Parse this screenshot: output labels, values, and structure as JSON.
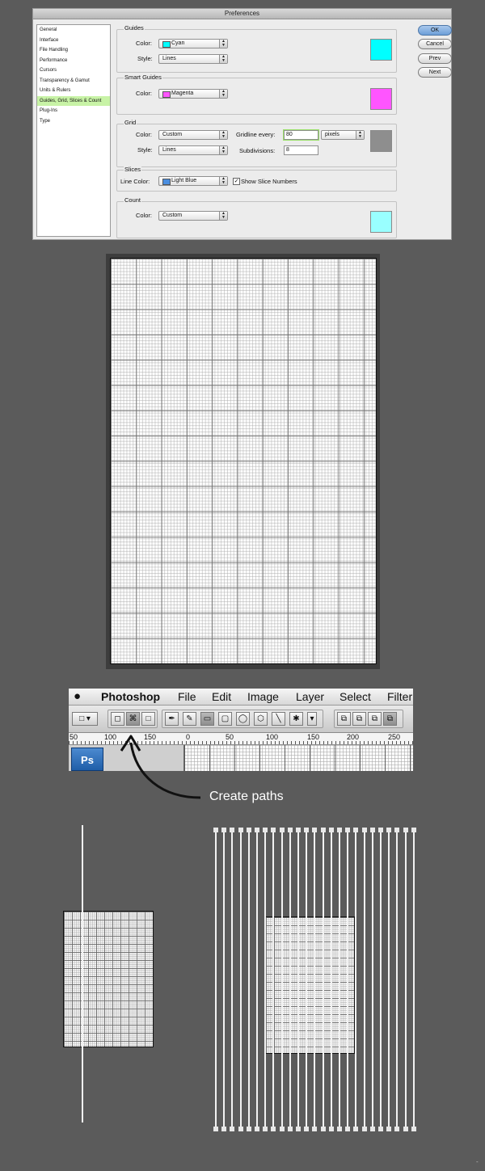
{
  "preferences": {
    "title": "Preferences",
    "categories": [
      "General",
      "Interface",
      "File Handling",
      "Performance",
      "Cursors",
      "Transparency & Gamut",
      "Units & Rulers",
      "Guides, Grid, Slices & Count",
      "Plug-Ins",
      "Type"
    ],
    "selected_category": "Guides, Grid, Slices & Count",
    "guides": {
      "title": "Guides",
      "color_label": "Color:",
      "color_value": "Cyan",
      "color_hex": "#00ffff",
      "style_label": "Style:",
      "style_value": "Lines"
    },
    "smart_guides": {
      "title": "Smart Guides",
      "color_label": "Color:",
      "color_value": "Magenta",
      "color_hex": "#ff55ff"
    },
    "grid": {
      "title": "Grid",
      "color_label": "Color:",
      "color_value": "Custom",
      "color_hex": "#8e8e8e",
      "style_label": "Style:",
      "style_value": "Lines",
      "gridline_label": "Gridline every:",
      "gridline_value": "80",
      "unit_value": "pixels",
      "subdivisions_label": "Subdivisions:",
      "subdivisions_value": "8"
    },
    "slices": {
      "title": "Slices",
      "line_color_label": "Line Color:",
      "line_color_value": "Light Blue",
      "line_color_hex": "#4a8ee0",
      "show_numbers_label": "Show Slice Numbers",
      "show_numbers_checked": true
    },
    "count": {
      "title": "Count",
      "color_label": "Color:",
      "color_value": "Custom",
      "color_hex": "#99ffff"
    },
    "buttons": {
      "ok": "OK",
      "cancel": "Cancel",
      "prev": "Prev",
      "next": "Next"
    }
  },
  "photoshop": {
    "menus": [
      "Photoshop",
      "File",
      "Edit",
      "Image",
      "Layer",
      "Select",
      "Filter"
    ],
    "ruler_labels": [
      "50",
      "100",
      "150",
      "0",
      "50",
      "100",
      "150",
      "200",
      "250"
    ],
    "app_icon": "Ps"
  },
  "callout": {
    "text": "Create paths"
  },
  "icons": {
    "apple": "apple-icon",
    "pen": "pen-icon",
    "arrow": "curved-arrow-icon"
  }
}
